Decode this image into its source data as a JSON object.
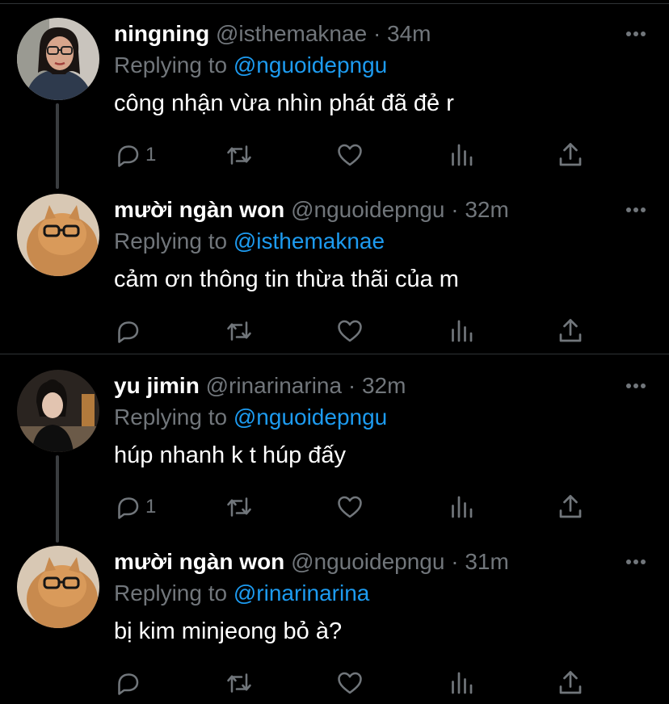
{
  "colors": {
    "background": "#000000",
    "accent": "#1d9bf0",
    "muted": "#71767b",
    "text": "#ffffff",
    "divider": "#2f3336"
  },
  "tweets": [
    {
      "name": "ningning",
      "handle": "@isthemaknae",
      "time": "· 34m",
      "reply_prefix": "Replying to",
      "reply_to": "@nguoidepngu",
      "text": "công nhận vừa nhìn phát đã đẻ r",
      "reply_count": "1",
      "avatar": "avatar-ningning"
    },
    {
      "name": "mười ngàn won",
      "handle": "@nguoidepngu",
      "time": "· 32m",
      "reply_prefix": "Replying to",
      "reply_to": "@isthemaknae",
      "text": "cảm ơn thông tin thừa thãi của m",
      "reply_count": "",
      "avatar": "avatar-cat"
    },
    {
      "name": "yu jimin",
      "handle": "@rinarinarina",
      "time": "· 32m",
      "reply_prefix": "Replying to",
      "reply_to": "@nguoidepngu",
      "text": "húp nhanh k t húp đấy",
      "reply_count": "1",
      "avatar": "avatar-yujimin"
    },
    {
      "name": "mười ngàn won",
      "handle": "@nguoidepngu",
      "time": "· 31m",
      "reply_prefix": "Replying to",
      "reply_to": "@rinarinarina",
      "text": "bị kim minjeong bỏ à?",
      "reply_count": "",
      "avatar": "avatar-cat"
    }
  ],
  "icons": [
    "reply-icon",
    "retweet-icon",
    "like-icon",
    "analytics-icon",
    "share-icon",
    "more-icon"
  ]
}
